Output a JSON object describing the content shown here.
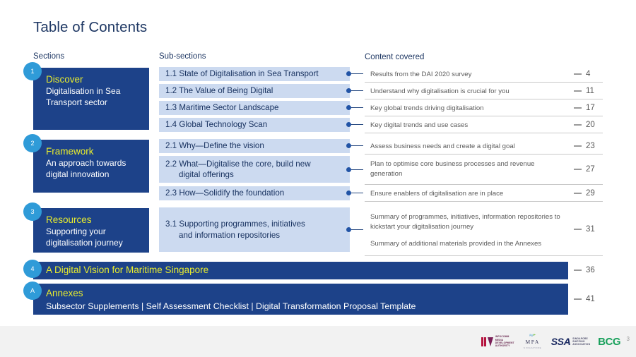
{
  "slide": {
    "title": "Table of Contents",
    "slide_number": "3"
  },
  "columns": {
    "sections": "Sections",
    "subsections": "Sub-sections",
    "content": "Content covered"
  },
  "sections": [
    {
      "badge": "1",
      "title": "Discover",
      "subtitle": "Digitalisation in Sea Transport sector",
      "subsections": [
        {
          "label": "1.1 State of Digitalisation in Sea Transport",
          "content": [
            "Results from the DAI 2020 survey"
          ],
          "page": "4"
        },
        {
          "label": "1.2 The Value of Being Digital",
          "content": [
            "Understand why digitalisation is crucial for you"
          ],
          "page": "11"
        },
        {
          "label": "1.3 Maritime Sector Landscape",
          "content": [
            "Key global trends driving digitalisation"
          ],
          "page": "17"
        },
        {
          "label": "1.4 Global Technology Scan",
          "content": [
            "Key digital trends and use cases"
          ],
          "page": "20"
        }
      ]
    },
    {
      "badge": "2",
      "title": "Framework",
      "subtitle": "An approach towards digital innovation",
      "subsections": [
        {
          "label": "2.1 Why—Define the vision",
          "content": [
            "Assess business needs and create a digital goal"
          ],
          "page": "23"
        },
        {
          "label": "2.2 What—Digitalise the core, build new digital offerings",
          "content": [
            "Plan to optimise core business processes and revenue generation"
          ],
          "page": "27"
        },
        {
          "label": "2.3 How—Solidify the foundation",
          "content": [
            "Ensure enablers of digitalisation are in place"
          ],
          "page": "29"
        }
      ]
    },
    {
      "badge": "3",
      "title": "Resources",
      "subtitle": "Supporting your digitalisation journey",
      "subsections": [
        {
          "label": "3.1 Supporting programmes, initiatives and information repositories",
          "content": [
            "Summary of programmes, initiatives, information repositories to kickstart your digitalisation journey",
            "Summary of additional materials provided in the Annexes"
          ],
          "page": "31"
        }
      ]
    }
  ],
  "wide_bars": [
    {
      "badge": "4",
      "title": "A Digital Vision for Maritime Singapore",
      "subtitle": "",
      "page": "36"
    },
    {
      "badge": "A",
      "title": "Annexes",
      "subtitle": "Subsector Supplements | Self Assessment Checklist | Digital Transformation Proposal Template",
      "page": "41"
    }
  ],
  "footer": {
    "logos": [
      {
        "name": "imda-logo",
        "text": "INFOCOMM MEDIA DEVELOPMENT AUTHORITY"
      },
      {
        "name": "mpa-logo",
        "text": "MPA",
        "sub": "SINGAPORE"
      },
      {
        "name": "ssa-logo",
        "text": "SSA",
        "sub": "SINGAPORE SHIPPING ASSOCIATION"
      },
      {
        "name": "bcg-logo",
        "text": "BCG"
      }
    ]
  },
  "colors": {
    "dark_blue": "#1d4289",
    "light_blue_box": "#ccdaf0",
    "badge_blue": "#2f9bd8",
    "yellow": "#e8ec2e",
    "title_navy": "#1f3864"
  }
}
